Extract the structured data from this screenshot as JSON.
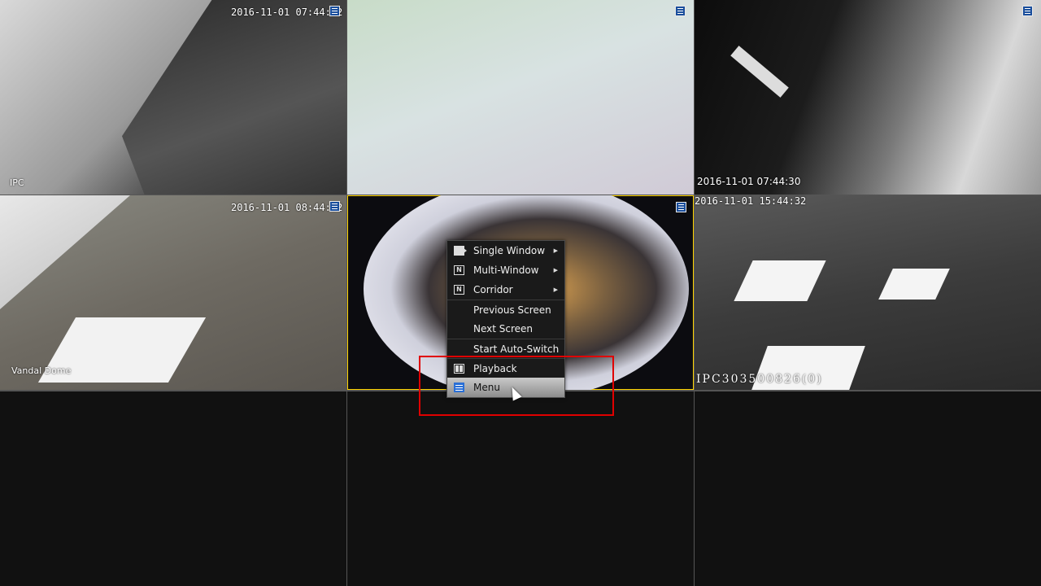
{
  "cells": [
    {
      "timestamp": "2016-11-01 07:44:32 AM",
      "label": "IPC",
      "has_rec_icon": true
    },
    {
      "timestamp": "",
      "label": "",
      "has_rec_icon": true
    },
    {
      "timestamp": "2016-11-01 07:44:30",
      "label": "",
      "has_rec_icon": true
    },
    {
      "timestamp": "2016-11-01 08:44:32",
      "label": "Vandal Dome",
      "has_rec_icon": true
    },
    {
      "timestamp": "",
      "label": "",
      "has_rec_icon": true,
      "selected": true
    },
    {
      "timestamp": "2016-11-01 15:44:32",
      "label": "IPC303500826(0)",
      "has_rec_icon": true
    },
    {
      "timestamp": "",
      "label": ""
    },
    {
      "timestamp": "",
      "label": ""
    },
    {
      "timestamp": "",
      "label": ""
    }
  ],
  "context_menu": {
    "items": [
      {
        "label": "Single Window",
        "icon": "single-window-icon",
        "submenu": true
      },
      {
        "label": "Multi-Window",
        "icon": "multi-window-icon",
        "submenu": true
      },
      {
        "label": "Corridor",
        "icon": "corridor-icon",
        "submenu": true
      },
      {
        "label": "Previous Screen",
        "icon": "",
        "submenu": false
      },
      {
        "label": "Next Screen",
        "icon": "",
        "submenu": false
      },
      {
        "label": "Start Auto-Switch",
        "icon": "",
        "submenu": false
      },
      {
        "label": "Playback",
        "icon": "playback-icon",
        "submenu": false
      },
      {
        "label": "Menu",
        "icon": "menu-list-icon",
        "submenu": false,
        "hovered": true
      }
    ]
  },
  "colors": {
    "selected_border": "#ffd400",
    "highlight_box": "#e00000",
    "menu_hover": "#b0b0b0"
  }
}
